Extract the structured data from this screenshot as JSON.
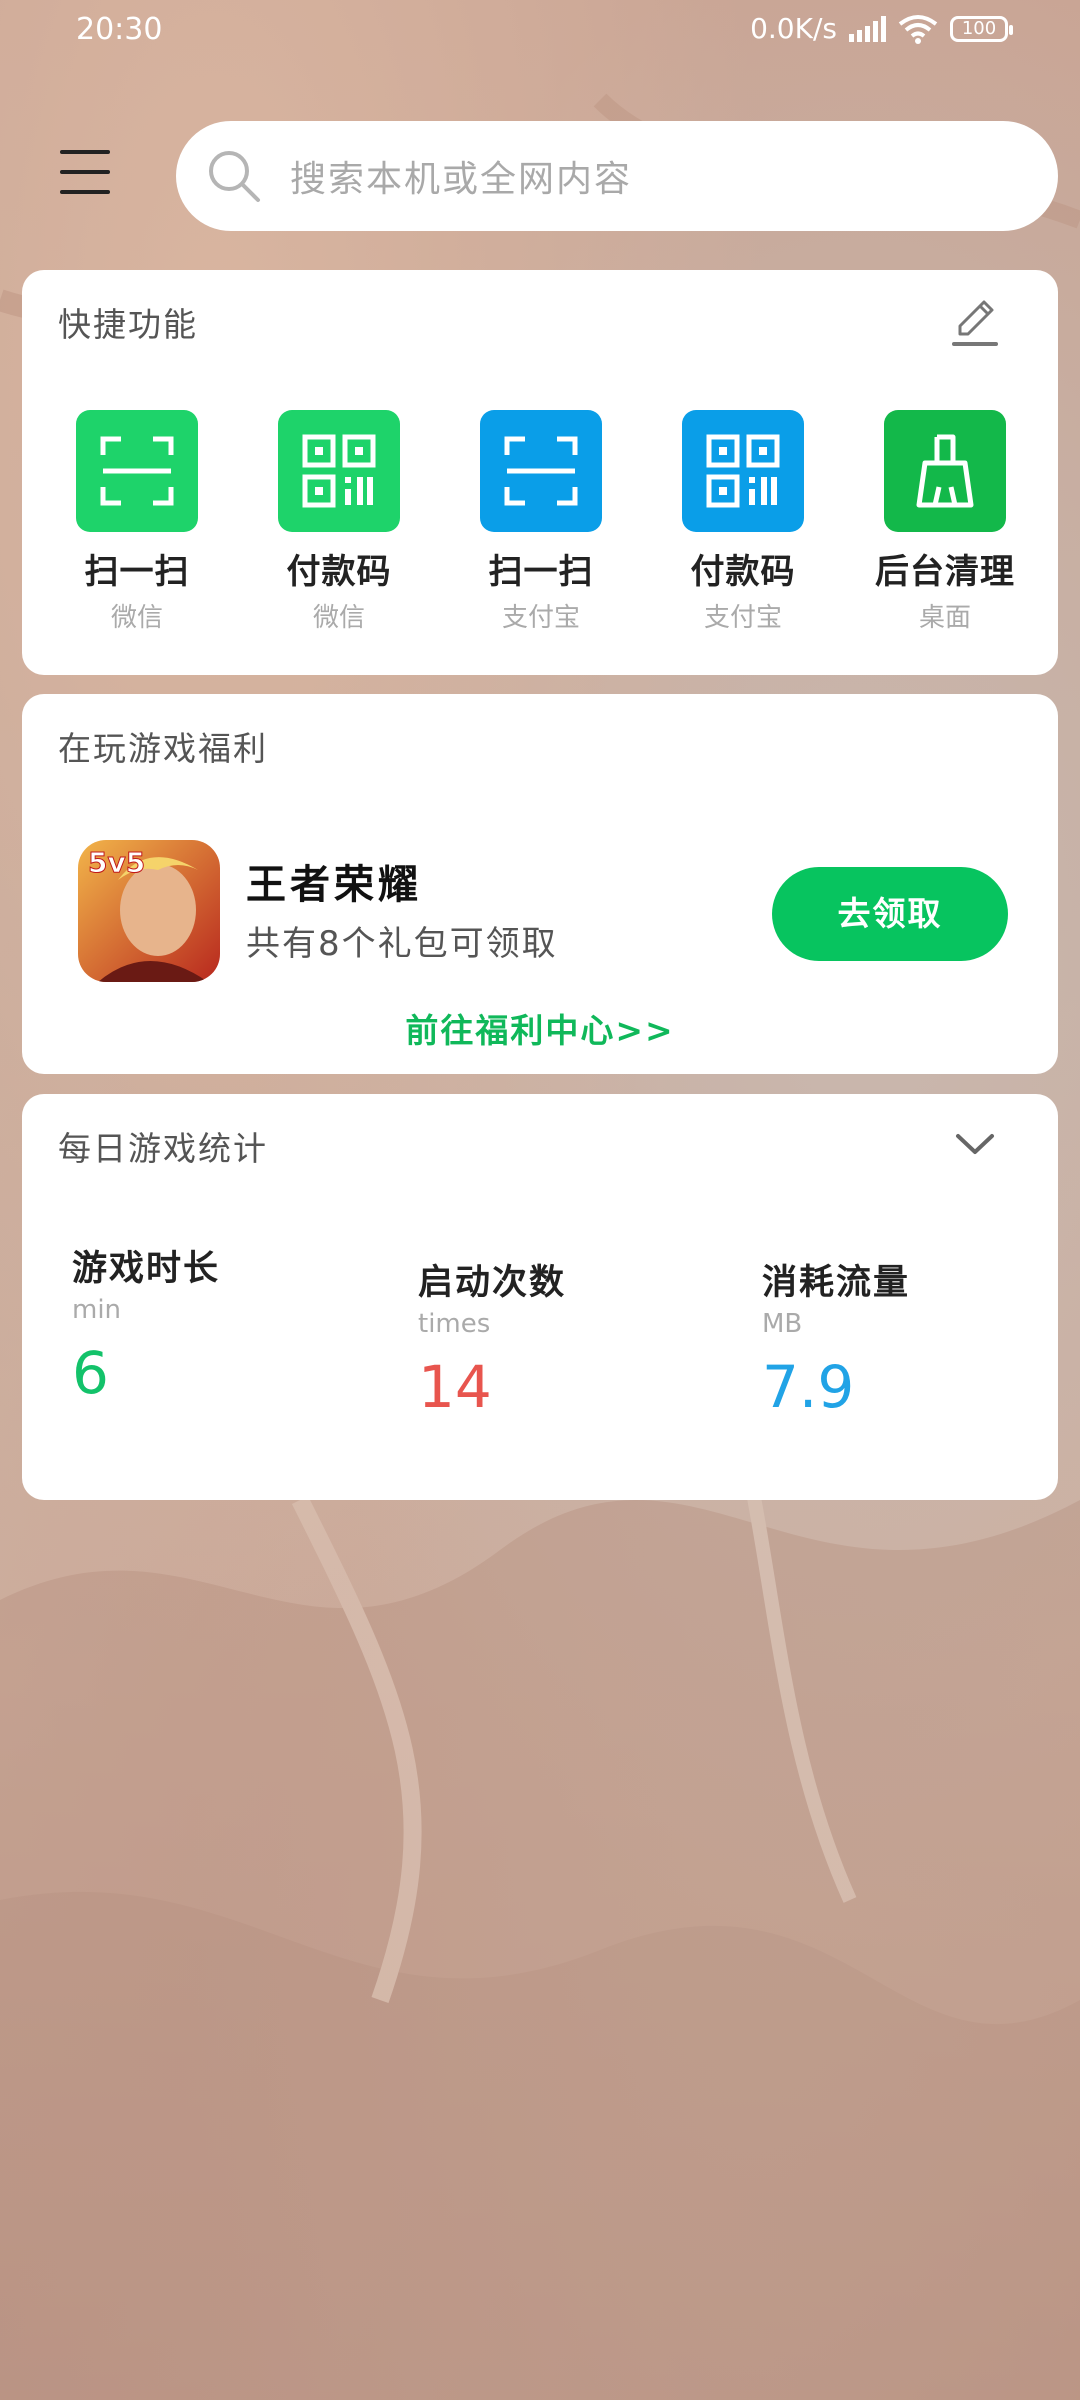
{
  "status_bar": {
    "time": "20:30",
    "net_speed": "0.0K/s",
    "battery": "100"
  },
  "search": {
    "placeholder": "搜索本机或全网内容"
  },
  "quick": {
    "title": "快捷功能",
    "items": [
      {
        "label": "扫一扫",
        "sub": "微信",
        "icon": "scan-icon",
        "color": "#1ed36a"
      },
      {
        "label": "付款码",
        "sub": "微信",
        "icon": "qr-code-icon",
        "color": "#1ed36a"
      },
      {
        "label": "扫一扫",
        "sub": "支付宝",
        "icon": "scan-icon",
        "color": "#0a9ee8"
      },
      {
        "label": "付款码",
        "sub": "支付宝",
        "icon": "qr-code-icon",
        "color": "#0a9ee8"
      },
      {
        "label": "后台清理",
        "sub": "桌面",
        "icon": "broom-icon",
        "color": "#13b84a"
      }
    ]
  },
  "gift": {
    "title": "在玩游戏福利",
    "game_name": "王者荣耀",
    "game_icon_text": "5v5",
    "description": "共有8个礼包可领取",
    "claim_button": "去领取",
    "center_link": "前往福利中心>>"
  },
  "stats": {
    "title": "每日游戏统计",
    "items": [
      {
        "name": "游戏时长",
        "unit": "min",
        "value": "6",
        "color": "#13c26a"
      },
      {
        "name": "启动次数",
        "unit": "times",
        "value": "14",
        "color": "#e8554e"
      },
      {
        "name": "消耗流量",
        "unit": "MB",
        "value": "7.9",
        "color": "#21a3e6"
      }
    ]
  }
}
